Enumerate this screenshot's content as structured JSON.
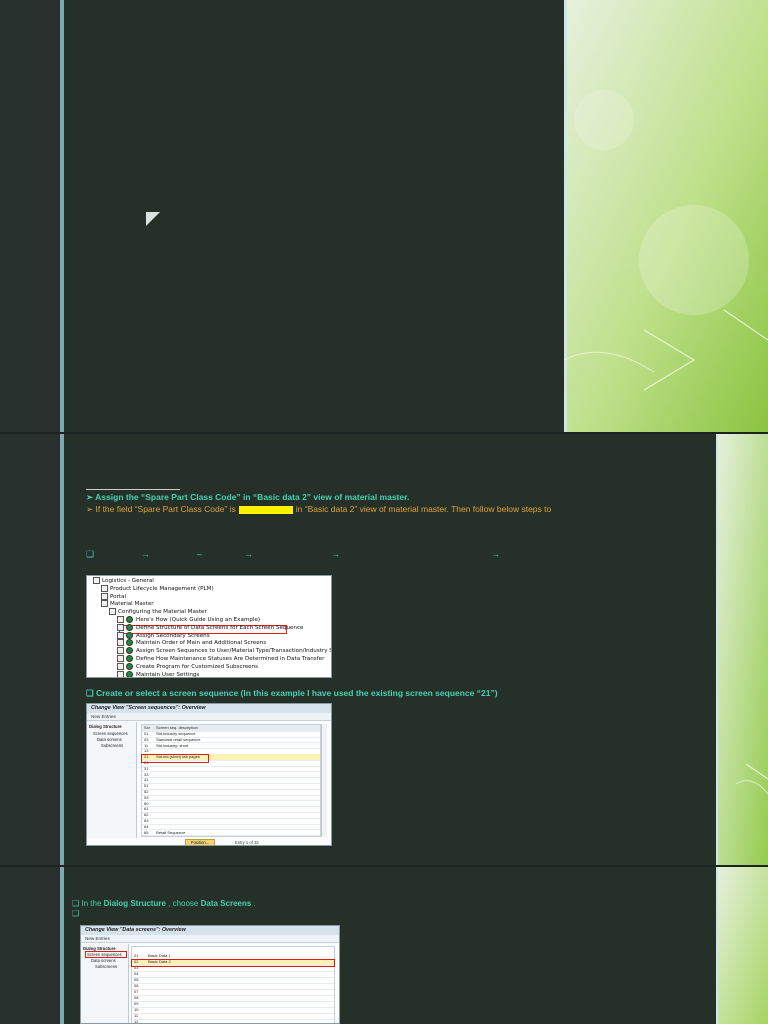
{
  "slide1": {
    "colors": {
      "bg": "#27302c",
      "accent": "#7fa9b0",
      "green": "#b7dc76"
    }
  },
  "slide2": {
    "bullet1": "➢ Assign the “Spare Part Class Code” in “Basic data 2” view of material master.",
    "bullet2_pre": "➢ If the field “Spare Part Class Code” is",
    "bullet2_post": "in “Basic data 2” view of material master. Then follow below steps to",
    "path_row": {
      "checkbox": "❑",
      "arrows": [
        "→",
        "–",
        "→",
        "→",
        "→"
      ]
    },
    "tree": [
      {
        "label": "Logistics - General",
        "level": 0,
        "clock": false
      },
      {
        "label": "Product Lifecycle Management (PLM)",
        "level": 1,
        "clock": false
      },
      {
        "label": "Portal",
        "level": 1,
        "clock": false
      },
      {
        "label": "Material Master",
        "level": 1,
        "clock": false
      },
      {
        "label": "Configuring the Material Master",
        "level": 2,
        "clock": false
      },
      {
        "label": "Here's How (Quick Guide Using an Example)",
        "level": 3,
        "clock": true
      },
      {
        "label": "Define Structure of Data Screens for Each Screen Sequence",
        "level": 3,
        "clock": true
      },
      {
        "label": "Assign Secondary Screens",
        "level": 3,
        "clock": true
      },
      {
        "label": "Maintain Order of Main and Additional Screens",
        "level": 3,
        "clock": true
      },
      {
        "label": "Assign Screen Sequences to User/Material Type/Transaction/Industry Sector",
        "level": 3,
        "clock": true
      },
      {
        "label": "Define How Maintenance Statuses Are Determined in Data Transfer",
        "level": 3,
        "clock": true
      },
      {
        "label": "Create Program for Customized Subscreens",
        "level": 3,
        "clock": true
      },
      {
        "label": "Maintain User Settings",
        "level": 3,
        "clock": true
      }
    ],
    "step2": "❑ Create or select a screen sequence (In this example I have used the existing screen sequence “21”)",
    "sap1": {
      "title": "Change View \"Screen sequences\": Overview",
      "toolbar": "New Entries",
      "dialog_title": "Dialog Structure",
      "dialog_items": [
        "Screen sequences",
        "Data screens",
        "Subscreens"
      ],
      "col_headers": [
        "Scr",
        "Screen seq. description"
      ],
      "rows": [
        [
          "01",
          "Std.industry sequence"
        ],
        [
          "03",
          "Standard retail sequence"
        ],
        [
          "11",
          "Std.industry: short"
        ],
        [
          "13",
          ""
        ],
        [
          "21",
          "Std.ind.(short) tab pages"
        ],
        [
          "23",
          ""
        ],
        [
          "31",
          ""
        ],
        [
          "33",
          ""
        ],
        [
          "41",
          ""
        ],
        [
          "51",
          ""
        ],
        [
          "52",
          ""
        ],
        [
          "53",
          ""
        ],
        [
          "60",
          ""
        ],
        [
          "61",
          ""
        ],
        [
          "62",
          ""
        ],
        [
          "63",
          ""
        ],
        [
          "64",
          ""
        ],
        [
          "65",
          "Retail Sequence"
        ]
      ],
      "position_btn": "Position...",
      "entry_text": "Entry 1 of 32"
    },
    "colors": {
      "teal": "#48d0b3",
      "orange": "#e0a13b",
      "highlight": "#fff200",
      "red": "#e01a1a"
    }
  },
  "slide3": {
    "step3_pre": "❑ In the",
    "step3_ds": "Dialog Structure",
    "step3_mid": ", choose",
    "step3_dsc": "Data Screens",
    "step3_end": ".",
    "step4": "❑",
    "sap2": {
      "title": "Change View \"Data screens\": Overview",
      "toolbar": "New Entries",
      "dialog_title": "Dialog Structure",
      "dialog_items": [
        "Screen sequences",
        "Data screens",
        "Subscreens"
      ],
      "rows": [
        [
          "01",
          "Basic Data 1"
        ],
        [
          "02",
          "Basic Data 2"
        ],
        [
          "03",
          ""
        ],
        [
          "04",
          ""
        ],
        [
          "05",
          ""
        ],
        [
          "06",
          ""
        ],
        [
          "07",
          ""
        ],
        [
          "08",
          ""
        ],
        [
          "09",
          ""
        ],
        [
          "10",
          ""
        ],
        [
          "11",
          ""
        ],
        [
          "12",
          ""
        ]
      ]
    }
  }
}
